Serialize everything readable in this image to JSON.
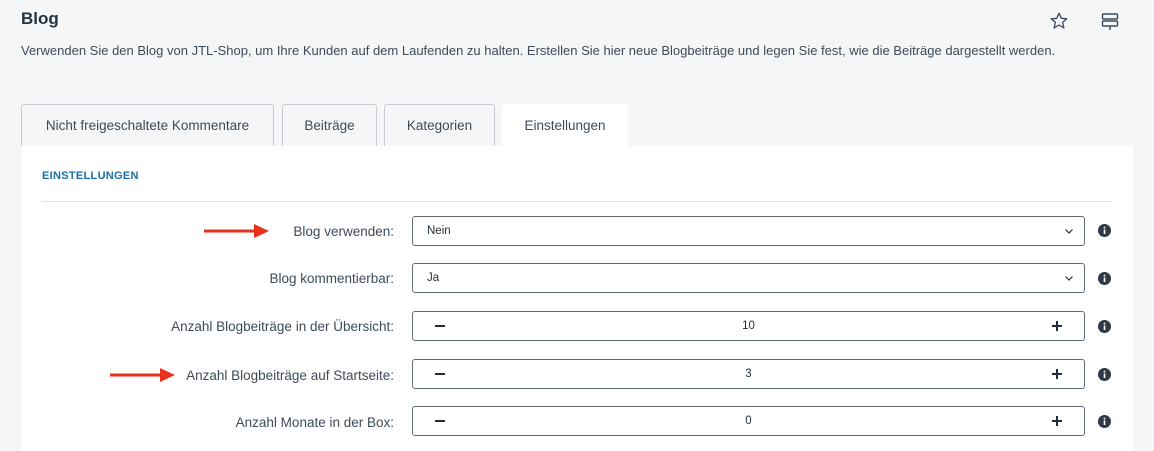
{
  "header": {
    "title": "Blog",
    "description": "Verwenden Sie den Blog von JTL-Shop, um Ihre Kunden auf dem Laufenden zu halten. Erstellen Sie hier neue Blogbeiträge und legen Sie fest, wie die Beiträge dargestellt werden.",
    "icons": [
      "star-icon",
      "settings-icon"
    ]
  },
  "tabs": [
    {
      "label": "Nicht freigeschaltete Kommentare",
      "active": false
    },
    {
      "label": "Beiträge",
      "active": false
    },
    {
      "label": "Kategorien",
      "active": false
    },
    {
      "label": "Einstellungen",
      "active": true
    }
  ],
  "panel": {
    "section_title": "EINSTELLUNGEN",
    "rows": [
      {
        "label": "Blog verwenden:",
        "type": "select",
        "value": "Nein",
        "highlighted": true
      },
      {
        "label": "Blog kommentierbar:",
        "type": "select",
        "value": "Ja",
        "highlighted": false
      },
      {
        "label": "Anzahl Blogbeiträge in der Übersicht:",
        "type": "stepper",
        "value": "10",
        "highlighted": false
      },
      {
        "label": "Anzahl Blogbeiträge auf Startseite:",
        "type": "stepper",
        "value": "3",
        "highlighted": true
      },
      {
        "label": "Anzahl Monate in der Box:",
        "type": "stepper",
        "value": "0",
        "highlighted": false
      }
    ]
  },
  "colors": {
    "background": "#f4f6f8",
    "panel": "#ffffff",
    "accent": "#1a6ea8",
    "arrow": "#e8321e",
    "border": "#5f6b76"
  }
}
